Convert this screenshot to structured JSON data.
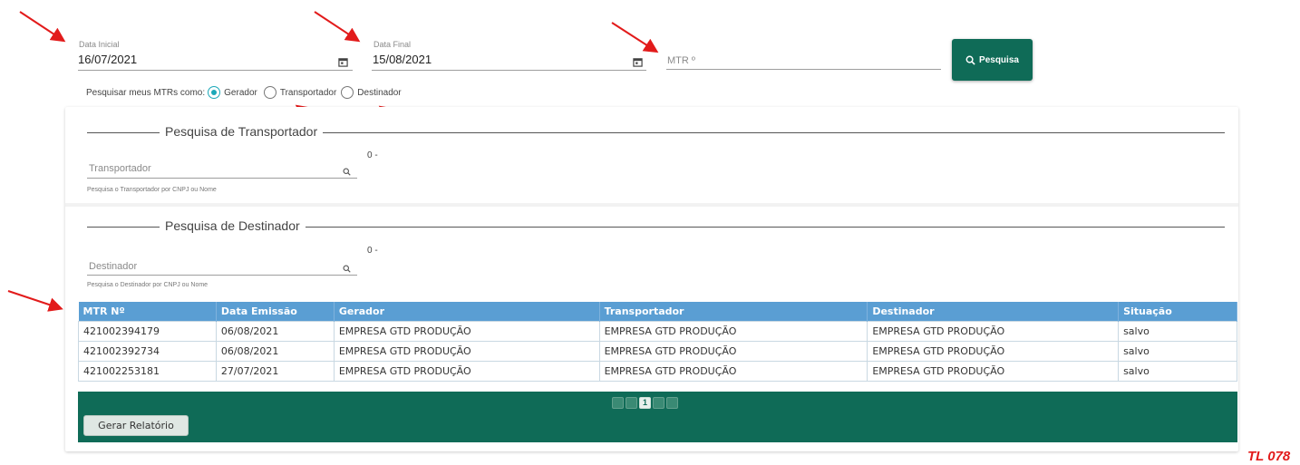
{
  "filters": {
    "start_date": {
      "label": "Data Inicial",
      "value": "16/07/2021",
      "icon": "calendar-icon"
    },
    "end_date": {
      "label": "Data Final",
      "value": "15/08/2021",
      "icon": "calendar-icon"
    },
    "mtr": {
      "placeholder": "MTR º"
    },
    "search_button": {
      "label": "Pesquisa",
      "icon": "search-icon"
    }
  },
  "search_as": {
    "label": "Pesquisar meus MTRs como:",
    "options": [
      {
        "label": "Gerador",
        "checked": true
      },
      {
        "label": "Transportador",
        "checked": false
      },
      {
        "label": "Destinador",
        "checked": false
      }
    ]
  },
  "transportador_section": {
    "legend": "Pesquisa de Transportador",
    "placeholder": "Transportador",
    "hint": "Pesquisa o Transportador por CNPJ ou Nome",
    "count": "0 -"
  },
  "destinador_section": {
    "legend": "Pesquisa de Destinador",
    "placeholder": "Destinador",
    "hint": "Pesquisa o Destinador por CNPJ ou Nome",
    "count": "0 -"
  },
  "table": {
    "headers": [
      "MTR Nº",
      "Data Emissão",
      "Gerador",
      "Transportador",
      "Destinador",
      "Situação"
    ],
    "rows": [
      [
        "421002394179",
        "06/08/2021",
        "EMPRESA GTD PRODUÇÃO",
        "EMPRESA GTD PRODUÇÃO",
        "EMPRESA GTD PRODUÇÃO",
        "salvo"
      ],
      [
        "421002392734",
        "06/08/2021",
        "EMPRESA GTD PRODUÇÃO",
        "EMPRESA GTD PRODUÇÃO",
        "EMPRESA GTD PRODUÇÃO",
        "salvo"
      ],
      [
        "421002253181",
        "27/07/2021",
        "EMPRESA GTD PRODUÇÃO",
        "EMPRESA GTD PRODUÇÃO",
        "EMPRESA GTD PRODUÇÃO",
        "salvo"
      ]
    ],
    "current_page": "1"
  },
  "report_button": {
    "label": "Gerar Relatório"
  },
  "tag": "TL 078",
  "colors": {
    "primary": "#0f6b57",
    "header": "#5a9ed3",
    "radio": "#1ba8b8",
    "annotation": "#e21b1b"
  }
}
